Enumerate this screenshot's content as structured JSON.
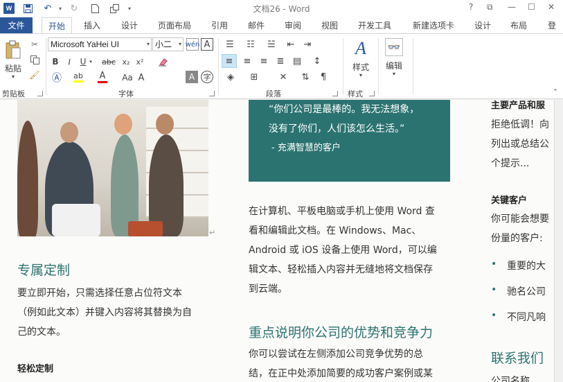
{
  "window": {
    "title": "文档26 - Word",
    "controls": [
      "?",
      "⧉",
      "—",
      "☐",
      "✕"
    ]
  },
  "quick_access": {
    "logo": "W"
  },
  "tabs": {
    "file": "文件",
    "items": [
      "开始",
      "插入",
      "设计",
      "页面布局",
      "引用",
      "邮件",
      "审阅",
      "视图",
      "开发工具",
      "新建选项卡",
      "设计",
      "布局",
      "登"
    ]
  },
  "ribbon": {
    "clipboard": {
      "paste": "粘贴",
      "label": "剪贴板"
    },
    "font": {
      "font_name": "Microsoft YaHei UI",
      "font_size": "小二",
      "label": "字体",
      "bold": "B",
      "italic": "I",
      "underline": "U",
      "strike": "abc",
      "sub": "x₂",
      "sup": "x²",
      "case": "Aa",
      "grow": "A",
      "shrink": "A",
      "font_color": "A",
      "highlight": "ab"
    },
    "paragraph": {
      "label": "段落"
    },
    "styles": {
      "button": "样式",
      "label": "样式"
    },
    "editing": {
      "button": "编辑"
    }
  },
  "doc": {
    "quote": {
      "line1": "“你们公司是最棒的。我无法想象，",
      "line2": "没有了你们，人们该怎么生活。”",
      "author": "- 充满智慧的客户"
    },
    "left": {
      "h1": "专属定制",
      "p1": [
        "要立即开始，只需选择任意占位符文本",
        "（例如此文本）并键入内容将其替换为自",
        "己的文本。"
      ],
      "h2": "轻松定制"
    },
    "middle": {
      "p1": [
        "在计算机、平板电脑或手机上使用 Word 查",
        "看和编辑此文档。在 Windows、Mac、",
        "Android 或 iOS 设备上使用 Word，可以编",
        "辑文本、轻松插入内容并无缝地将文档保存",
        "到云端。"
      ],
      "h1": "重点说明你公司的优势和竞争力",
      "p2": [
        "你可以尝试在左侧添加公司竞争优势的总",
        "结，在正中处添加简要的成功客户案例或某"
      ]
    },
    "right": {
      "h0": "主要产品和服",
      "p0": [
        "拒绝低调！向",
        "列出或总结公",
        "个提示..."
      ],
      "h1": "关键客户",
      "p1": [
        "你可能会想要",
        "份量的客户:"
      ],
      "bullets": [
        "重要的大",
        "驰名公司",
        "不同凡响"
      ],
      "h2": "联系我们",
      "p2": "公司名称"
    }
  }
}
